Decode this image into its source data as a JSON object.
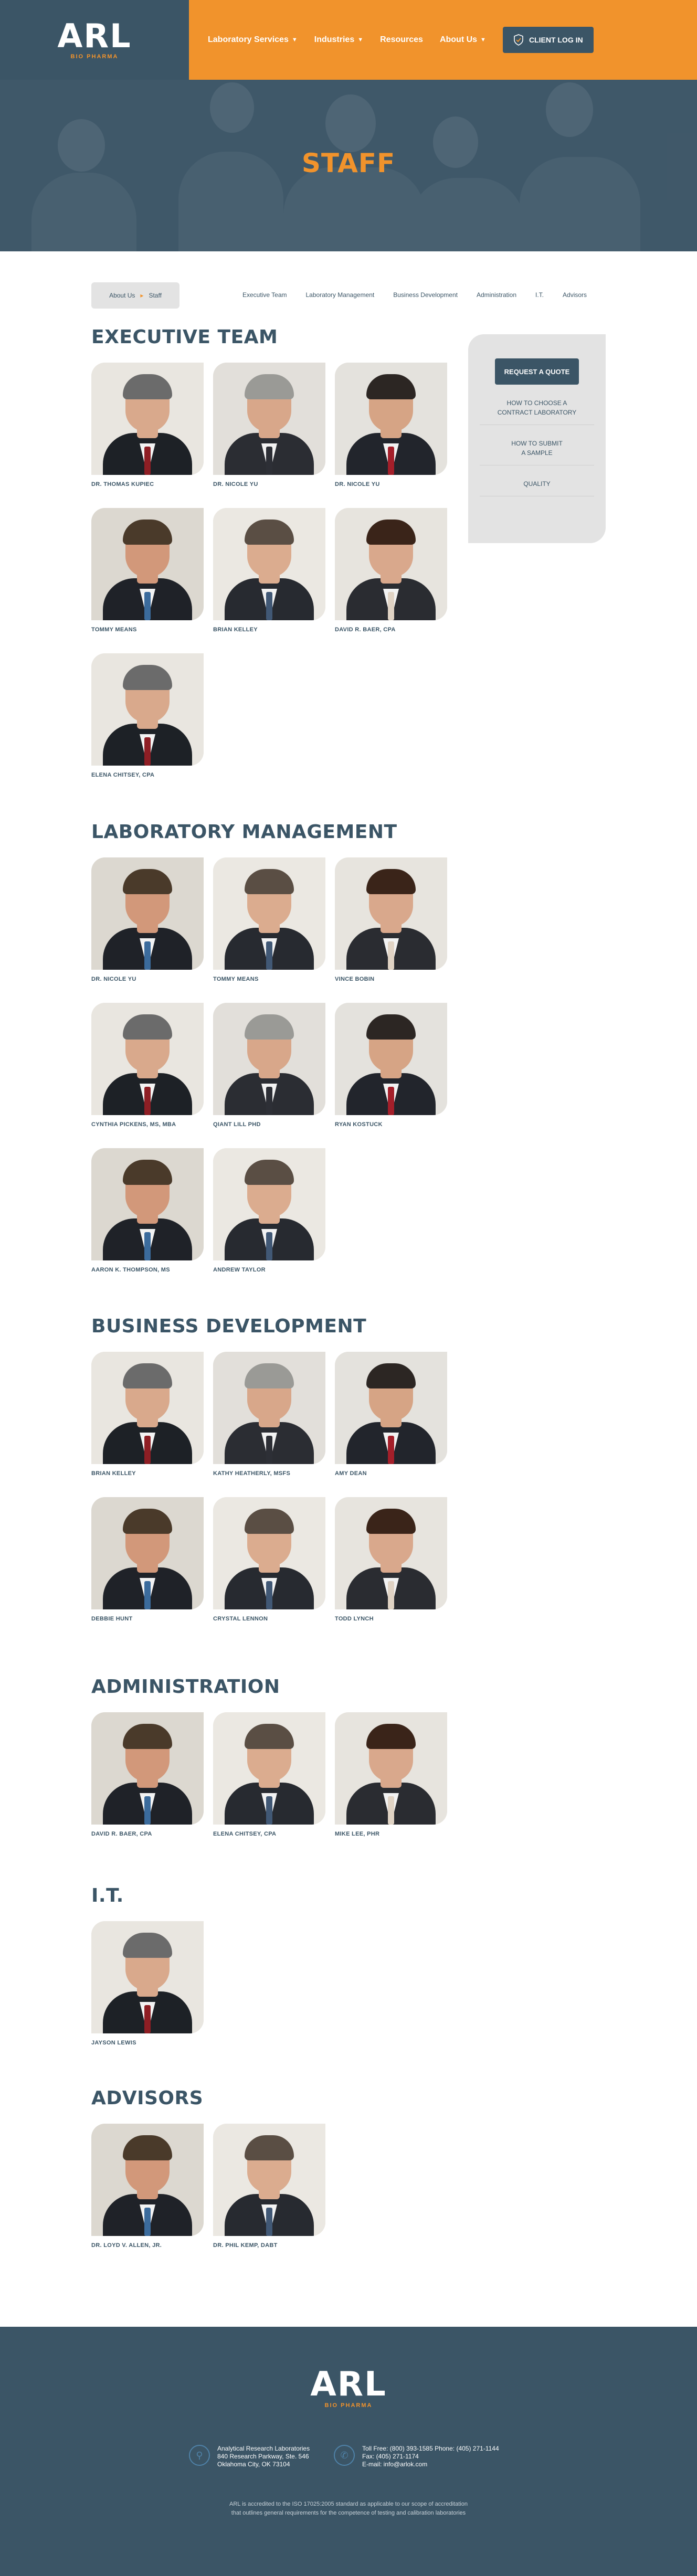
{
  "header": {
    "logo_text": "ARL",
    "logo_sub": "BIO PHARMA",
    "nav": [
      {
        "label": "Laboratory Services",
        "has_dropdown": true
      },
      {
        "label": "Industries",
        "has_dropdown": true
      },
      {
        "label": "Resources",
        "has_dropdown": false
      },
      {
        "label": "About Us",
        "has_dropdown": true
      }
    ],
    "login_label": "CLIENT LOG IN"
  },
  "hero": {
    "title": "STAFF"
  },
  "breadcrumb": {
    "home": "About Us",
    "current": "Staff"
  },
  "anchors": [
    "Executive Team",
    "Laboratory Management",
    "Business Development",
    "Administration",
    "I.T.",
    "Advisors"
  ],
  "sidebar": {
    "quote_label": "REQUEST A QUOTE",
    "links": [
      "HOW TO CHOOSE A\nCONTRACT LABORATORY",
      "HOW TO SUBMIT\nA SAMPLE",
      "QUALITY"
    ]
  },
  "sections": [
    {
      "title": "EXECUTIVE TEAM",
      "people": [
        "DR. THOMAS KUPIEC",
        "DR. NICOLE YU",
        "DR. NICOLE YU",
        "TOMMY MEANS",
        "BRIAN KELLEY",
        "DAVID R. BAER, CPA",
        "ELENA CHITSEY, CPA"
      ]
    },
    {
      "title": "LABORATORY MANAGEMENT",
      "people": [
        "DR. NICOLE YU",
        "TOMMY MEANS",
        "VINCE BOBIN",
        "CYNTHIA PICKENS, MS, MBA",
        "QIANT LILL PHD",
        "RYAN KOSTUCK",
        "AARON K. THOMPSON, MS",
        "ANDREW TAYLOR"
      ]
    },
    {
      "title": "BUSINESS DEVELOPMENT",
      "people": [
        "BRIAN KELLEY",
        "KATHY HEATHERLY, MSFS",
        "AMY DEAN",
        "DEBBIE HUNT",
        "CRYSTAL LENNON",
        "TODD LYNCH"
      ]
    },
    {
      "title": "ADMINISTRATION",
      "people": [
        "DAVID R. BAER, CPA",
        "ELENA CHITSEY, CPA",
        "MIKE LEE, PHR"
      ]
    },
    {
      "title": "I.T.",
      "people": [
        "JAYSON LEWIS"
      ]
    },
    {
      "title": "ADVISORS",
      "people": [
        "DR. LOYD V. ALLEN, JR.",
        "DR. PHIL KEMP, DABT"
      ]
    }
  ],
  "footer": {
    "logo_text": "ARL",
    "logo_sub": "BIO PHARMA",
    "address": [
      "Analytical Research Laboratories",
      "840 Research Parkway, Ste. 546",
      "Oklahoma City, OK 73104"
    ],
    "phones": [
      "Toll Free: (800) 393-1585 Phone: (405) 271-1144",
      "Fax: (405) 271-1174",
      "E-mail: info@arlok.com"
    ],
    "note": [
      "ARL is accredited to the ISO 17025:2005 standard as applicable to our scope of accreditation",
      "that outlines general requirements for the competence of testing and calibration laboratories"
    ]
  }
}
